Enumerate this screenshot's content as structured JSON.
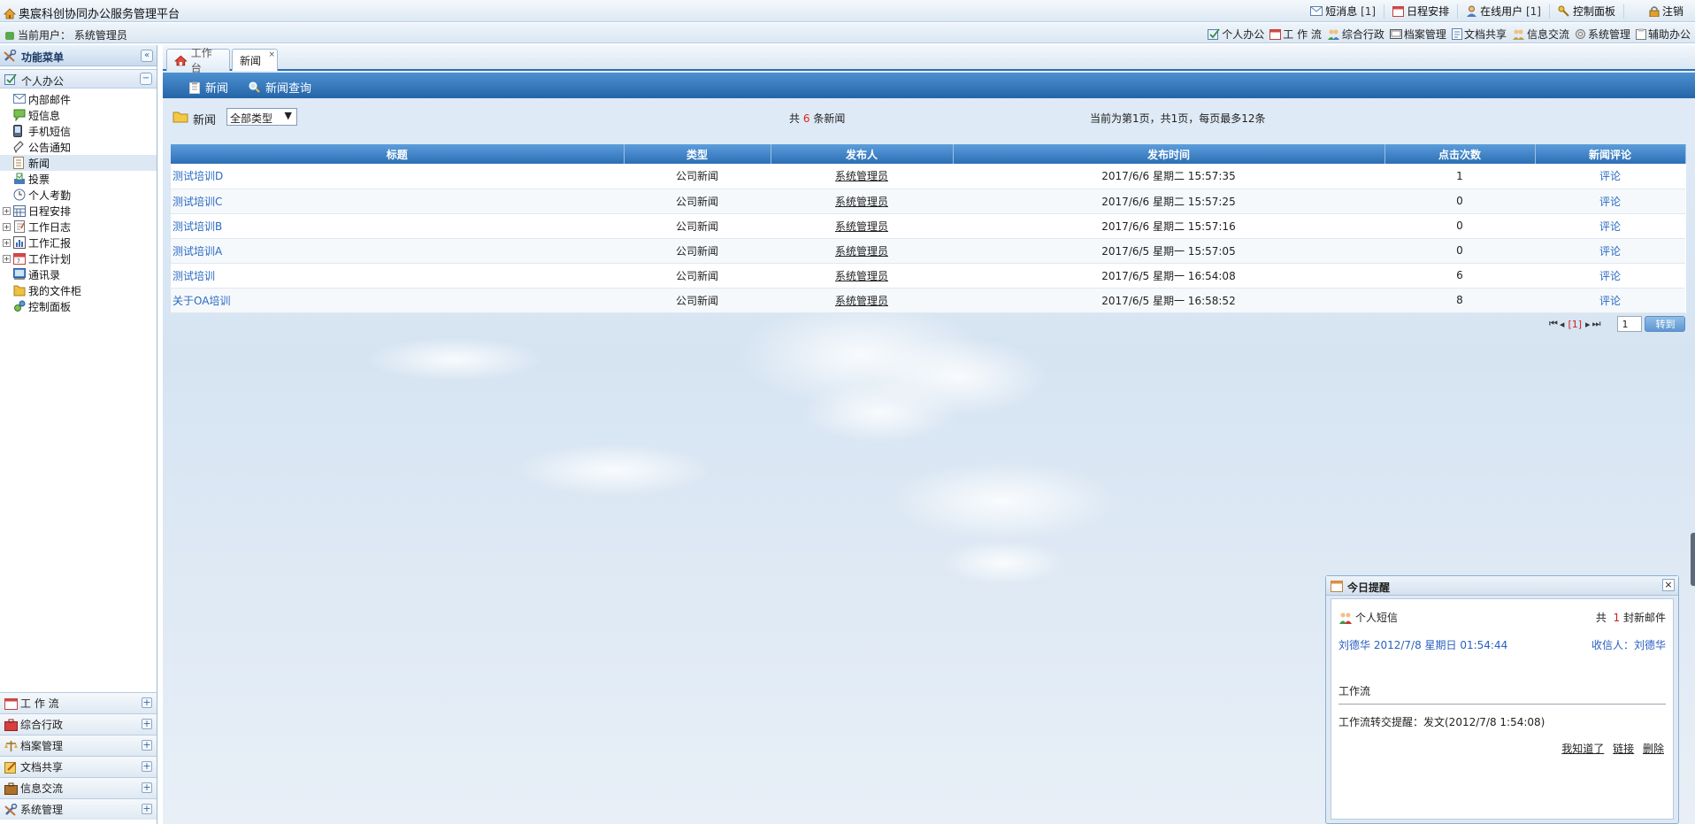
{
  "app": {
    "title": "奥宸科创协同办公服务管理平台"
  },
  "topnav": [
    {
      "label": "短消息",
      "count": "[1]",
      "icon": "envelope-icon"
    },
    {
      "label": "日程安排",
      "count": "",
      "icon": "calendar-icon"
    },
    {
      "label": "在线用户",
      "count": "[1]",
      "icon": "user-icon"
    },
    {
      "label": "控制面板",
      "count": "",
      "icon": "key-icon"
    },
    {
      "label": "注销",
      "count": "",
      "icon": "lock-icon"
    }
  ],
  "userbar": {
    "current_user": "当前用户： 系统管理员"
  },
  "modnav": [
    "个人办公",
    "工 作 流",
    "综合行政",
    "档案管理",
    "文档共享",
    "信息交流",
    "系统管理",
    "辅助办公"
  ],
  "sidebar": {
    "header": "功能菜单",
    "collapse": "«",
    "group": "个人办公",
    "group_toggle": "−",
    "items": [
      {
        "label": "内部邮件",
        "icon": "mail-icon",
        "expandable": false
      },
      {
        "label": "短信息",
        "icon": "chat-bubble-icon",
        "expandable": false
      },
      {
        "label": "手机短信",
        "icon": "mobile-icon",
        "expandable": false
      },
      {
        "label": "公告通知",
        "icon": "pen-icon",
        "expandable": false
      },
      {
        "label": "新闻",
        "icon": "newspaper-icon",
        "expandable": false
      },
      {
        "label": "投票",
        "icon": "vote-icon",
        "expandable": false
      },
      {
        "label": "个人考勤",
        "icon": "clock-icon",
        "expandable": false
      },
      {
        "label": "日程安排",
        "icon": "calendar-icon",
        "expandable": true
      },
      {
        "label": "工作日志",
        "icon": "notebook-icon",
        "expandable": true
      },
      {
        "label": "工作汇报",
        "icon": "bar-chart-icon",
        "expandable": true
      },
      {
        "label": "工作计划",
        "icon": "plan-calendar-icon",
        "expandable": true
      },
      {
        "label": "通讯录",
        "icon": "address-book-icon",
        "expandable": false
      },
      {
        "label": "我的文件柜",
        "icon": "folder-icon",
        "expandable": false
      },
      {
        "label": "控制面板",
        "icon": "settings-icon",
        "expandable": false
      }
    ],
    "bottom": [
      "工 作 流",
      "综合行政",
      "档案管理",
      "文档共享",
      "信息交流",
      "系统管理"
    ],
    "bottom_toggle": "+"
  },
  "tabs": [
    {
      "label": "工作台",
      "active": false
    },
    {
      "label": "新闻",
      "active": true,
      "close": "×"
    }
  ],
  "toolbar": {
    "news": "新闻",
    "news_query": "新闻查询"
  },
  "filter": {
    "label": "新闻",
    "type_value": "全部类型",
    "type_arrow": "▼",
    "total_prefix": "共",
    "total_count": "6",
    "total_suffix": "条新闻",
    "page_info": "当前为第1页，共1页，每页最多12条"
  },
  "table": {
    "headers": [
      "标题",
      "类型",
      "发布人",
      "发布时间",
      "点击次数",
      "新闻评论"
    ],
    "rows": [
      {
        "title": "测试培训D",
        "type": "公司新闻",
        "publisher": "系统管理员",
        "time": "2017/6/6 星期二 15:57:35",
        "clicks": "1",
        "comment": "评论"
      },
      {
        "title": "测试培训C",
        "type": "公司新闻",
        "publisher": "系统管理员",
        "time": "2017/6/6 星期二 15:57:25",
        "clicks": "0",
        "comment": "评论"
      },
      {
        "title": "测试培训B",
        "type": "公司新闻",
        "publisher": "系统管理员",
        "time": "2017/6/6 星期二 15:57:16",
        "clicks": "0",
        "comment": "评论"
      },
      {
        "title": "测试培训A",
        "type": "公司新闻",
        "publisher": "系统管理员",
        "time": "2017/6/5 星期一 15:57:05",
        "clicks": "0",
        "comment": "评论"
      },
      {
        "title": "测试培训",
        "type": "公司新闻",
        "publisher": "系统管理员",
        "time": "2017/6/5 星期一 16:54:08",
        "clicks": "6",
        "comment": "评论"
      },
      {
        "title": "关于OA培训",
        "type": "公司新闻",
        "publisher": "系统管理员",
        "time": "2017/6/5 星期一 16:58:52",
        "clicks": "8",
        "comment": "评论"
      }
    ]
  },
  "pager": {
    "first": "⏮",
    "prev": "◂",
    "current": "[1]",
    "next": "▸",
    "last": "⏭",
    "page_value": "1",
    "goto": "转到"
  },
  "reminder": {
    "title": "今日提醒",
    "close": "×",
    "sms_label": "个人短信",
    "mail_prefix": "共",
    "mail_count": "1",
    "mail_suffix": "封新邮件",
    "sender_line": "刘德华  2012/7/8 星期日 01:54:44",
    "recipient": "收信人：刘德华",
    "workflow_label": "工作流",
    "workflow_msg": "工作流转交提醒：发文(2012/7/8 1:54:08)",
    "actions": [
      "我知道了",
      "链接",
      "删除"
    ]
  },
  "colors": {
    "accent": "#2d6fb5",
    "link": "#2a6ac2",
    "highlight": "#e02020",
    "toolbar": "#2465a8"
  }
}
